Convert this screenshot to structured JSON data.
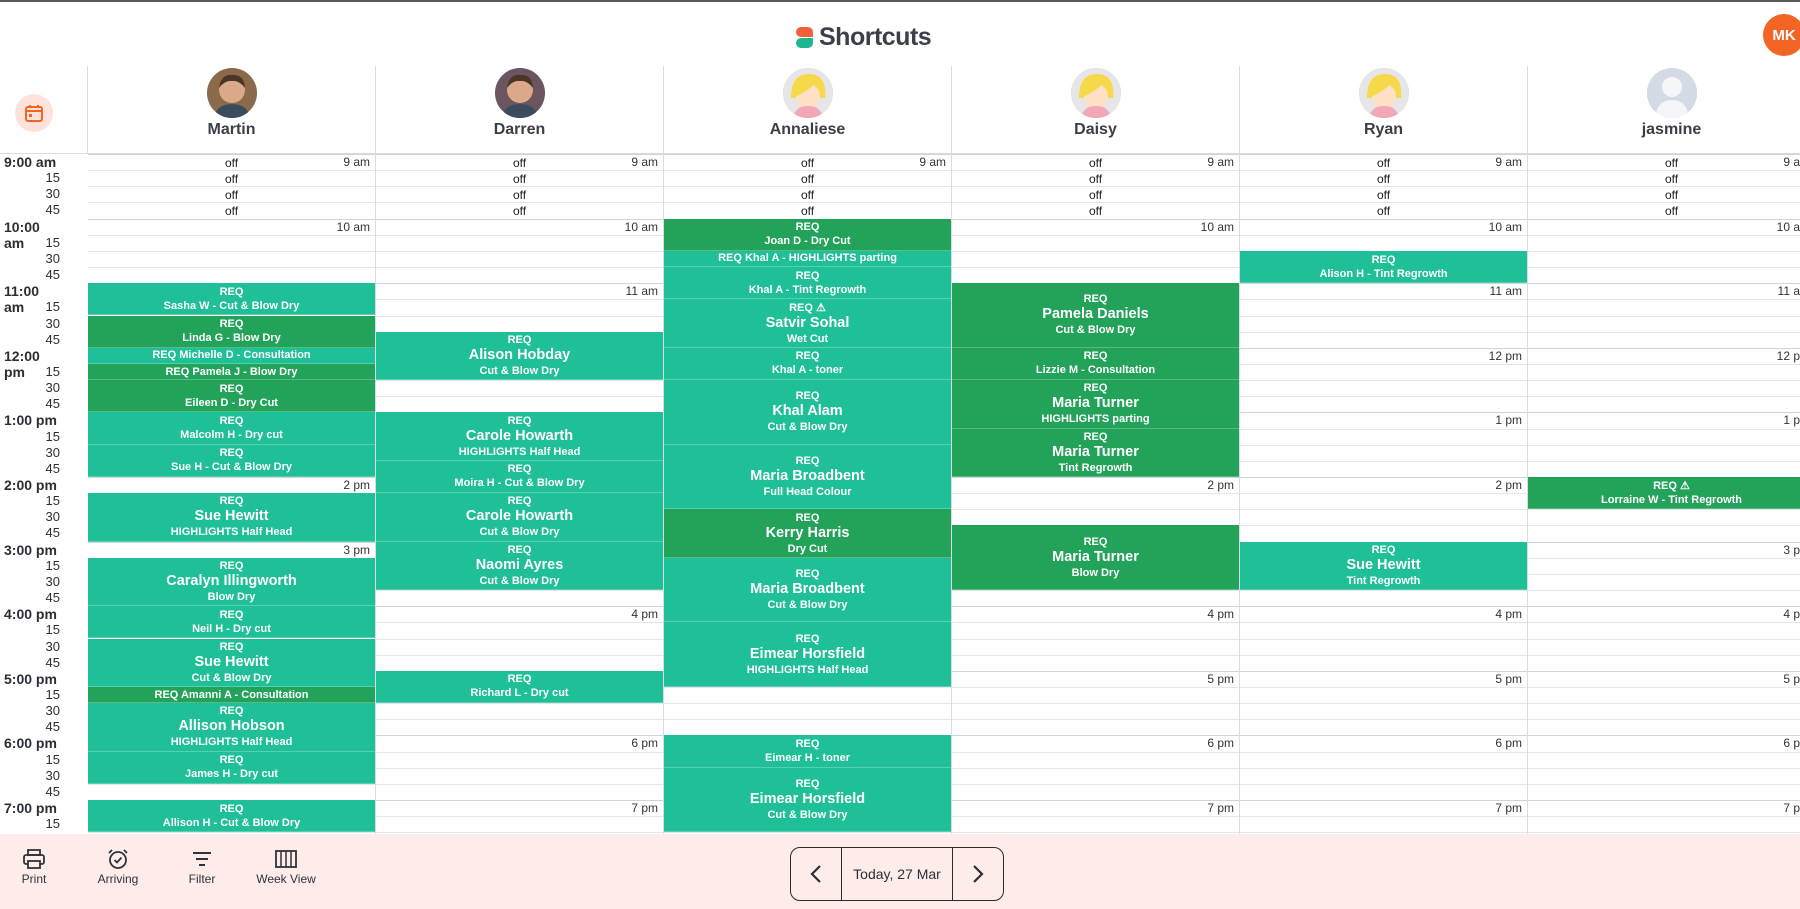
{
  "app": {
    "logo_text": "Shortcuts",
    "user_initials": "MK"
  },
  "colors": {
    "light_appt": "#1fbf97",
    "dark_appt": "#23a35a",
    "accent": "#f26524",
    "footer_bg": "#fdecea"
  },
  "time_labels": [
    "9:00 am",
    "15",
    "30",
    "45",
    "10:00 am",
    "15",
    "30",
    "45",
    "11:00 am",
    "15",
    "30",
    "45",
    "12:00 pm",
    "15",
    "30",
    "45",
    "1:00 pm",
    "15",
    "30",
    "45",
    "2:00 pm",
    "15",
    "30",
    "45",
    "3:00 pm",
    "15",
    "30",
    "45",
    "4:00 pm",
    "15",
    "30",
    "45",
    "5:00 pm",
    "15",
    "30",
    "45",
    "6:00 pm",
    "15",
    "30",
    "45",
    "7:00 pm",
    "15"
  ],
  "hour_markers": [
    "9 am",
    "10 am",
    "11 am",
    "12 pm",
    "1 pm",
    "2 pm",
    "3 pm",
    "4 pm",
    "5 pm",
    "6 pm",
    "7 pm"
  ],
  "off_label": "off",
  "staff": [
    {
      "name": "Martin",
      "photo": "photo",
      "photo_color": "#8a6a4a",
      "appointments": [
        {
          "start": 8,
          "span": 2,
          "style": "light",
          "lines": [
            "REQ",
            "Sasha W - Cut & Blow Dry"
          ]
        },
        {
          "start": 10,
          "span": 2,
          "style": "dark",
          "lines": [
            "REQ",
            "Linda G - Blow Dry"
          ]
        },
        {
          "start": 12,
          "span": 1,
          "style": "light",
          "lines": [
            "REQ  Michelle D - Consultation"
          ]
        },
        {
          "start": 13,
          "span": 1,
          "style": "dark",
          "lines": [
            "REQ  Pamela J - Blow Dry"
          ]
        },
        {
          "start": 14,
          "span": 2,
          "style": "dark",
          "lines": [
            "REQ",
            "Eileen D - Dry Cut"
          ]
        },
        {
          "start": 16,
          "span": 2,
          "style": "light",
          "lines": [
            "REQ",
            "Malcolm H - Dry cut"
          ]
        },
        {
          "start": 18,
          "span": 2,
          "style": "light",
          "lines": [
            "REQ",
            "Sue H - Cut & Blow Dry"
          ]
        },
        {
          "start": 21,
          "span": 3,
          "style": "light",
          "lines": [
            "REQ",
            "Sue Hewitt",
            "HIGHLIGHTS Half Head"
          ],
          "big": 1
        },
        {
          "start": 25,
          "span": 3,
          "style": "light",
          "lines": [
            "REQ",
            "Caralyn Illingworth",
            "Blow Dry"
          ],
          "big": 1
        },
        {
          "start": 28,
          "span": 2,
          "style": "light",
          "lines": [
            "REQ",
            "Neil H - Dry cut"
          ]
        },
        {
          "start": 30,
          "span": 3,
          "style": "light",
          "lines": [
            "REQ",
            "Sue Hewitt",
            "Cut & Blow Dry"
          ],
          "big": 1
        },
        {
          "start": 33,
          "span": 1,
          "style": "dark",
          "lines": [
            "REQ  Amanni A - Consultation"
          ]
        },
        {
          "start": 34,
          "span": 3,
          "style": "light",
          "lines": [
            "REQ",
            "Allison Hobson",
            "HIGHLIGHTS Half Head"
          ],
          "big": 1
        },
        {
          "start": 37,
          "span": 2,
          "style": "light",
          "lines": [
            "REQ",
            "James H - Dry cut"
          ]
        },
        {
          "start": 40,
          "span": 2,
          "style": "light",
          "lines": [
            "REQ",
            "Allison H - Cut & Blow Dry"
          ]
        }
      ]
    },
    {
      "name": "Darren",
      "photo": "photo",
      "photo_color": "#6a5560",
      "appointments": [
        {
          "start": 11,
          "span": 3,
          "style": "light",
          "lines": [
            "REQ",
            "Alison Hobday",
            "Cut & Blow Dry"
          ],
          "big": 1
        },
        {
          "start": 16,
          "span": 3,
          "style": "light",
          "lines": [
            "REQ",
            "Carole Howarth",
            "HIGHLIGHTS Half Head"
          ],
          "big": 1
        },
        {
          "start": 19,
          "span": 2,
          "style": "light",
          "lines": [
            "REQ",
            "Moira H - Cut & Blow Dry"
          ]
        },
        {
          "start": 21,
          "span": 3,
          "style": "light",
          "lines": [
            "REQ",
            "Carole Howarth",
            "Cut & Blow Dry"
          ],
          "big": 1
        },
        {
          "start": 24,
          "span": 3,
          "style": "light",
          "lines": [
            "REQ",
            "Naomi Ayres",
            "Cut & Blow Dry"
          ],
          "big": 1
        },
        {
          "start": 32,
          "span": 2,
          "style": "light",
          "lines": [
            "REQ",
            "Richard L - Dry cut"
          ]
        }
      ]
    },
    {
      "name": "Annaliese",
      "photo": "cartoon",
      "photo_color": "#e5e5e5",
      "appointments": [
        {
          "start": 4,
          "span": 2,
          "style": "dark",
          "lines": [
            "REQ",
            "Joan D - Dry Cut"
          ]
        },
        {
          "start": 6,
          "span": 1,
          "style": "light",
          "lines": [
            "REQ  Khal A - HIGHLIGHTS parting"
          ]
        },
        {
          "start": 7,
          "span": 2,
          "style": "light",
          "lines": [
            "REQ",
            "Khal A - Tint Regrowth"
          ]
        },
        {
          "start": 9,
          "span": 3,
          "style": "light",
          "lines": [
            "REQ ⚠",
            "Satvir Sohal",
            "Wet Cut"
          ],
          "big": 1
        },
        {
          "start": 12,
          "span": 2,
          "style": "light",
          "lines": [
            "REQ",
            "Khal A - toner"
          ]
        },
        {
          "start": 14,
          "span": 4,
          "style": "light",
          "lines": [
            "REQ",
            "Khal Alam",
            "Cut & Blow Dry"
          ],
          "big": 1
        },
        {
          "start": 18,
          "span": 4,
          "style": "light",
          "lines": [
            "REQ",
            "Maria Broadbent",
            "Full Head Colour"
          ],
          "big": 1
        },
        {
          "start": 22,
          "span": 3,
          "style": "dark",
          "lines": [
            "REQ",
            "Kerry Harris",
            "Dry Cut"
          ],
          "big": 1
        },
        {
          "start": 25,
          "span": 4,
          "style": "light",
          "lines": [
            "REQ",
            "Maria Broadbent",
            "Cut & Blow Dry"
          ],
          "big": 1
        },
        {
          "start": 29,
          "span": 4,
          "style": "light",
          "lines": [
            "REQ",
            "Eimear Horsfield",
            "HIGHLIGHTS Half Head"
          ],
          "big": 1
        },
        {
          "start": 36,
          "span": 2,
          "style": "light",
          "lines": [
            "REQ",
            "Eimear H - toner"
          ]
        },
        {
          "start": 38,
          "span": 4,
          "style": "light",
          "lines": [
            "REQ",
            "Eimear Horsfield",
            "Cut & Blow Dry"
          ],
          "big": 1
        }
      ]
    },
    {
      "name": "Daisy",
      "photo": "cartoon",
      "photo_color": "#e5e5e5",
      "appointments": [
        {
          "start": 8,
          "span": 4,
          "style": "dark",
          "lines": [
            "REQ",
            "Pamela Daniels",
            "Cut & Blow Dry"
          ],
          "big": 1
        },
        {
          "start": 12,
          "span": 2,
          "style": "dark",
          "lines": [
            "REQ",
            "Lizzie M - Consultation"
          ]
        },
        {
          "start": 14,
          "span": 3,
          "style": "dark",
          "lines": [
            "REQ",
            "Maria Turner",
            "HIGHLIGHTS parting"
          ],
          "big": 1
        },
        {
          "start": 17,
          "span": 3,
          "style": "dark",
          "lines": [
            "REQ",
            "Maria Turner",
            "Tint Regrowth"
          ],
          "big": 1
        },
        {
          "start": 23,
          "span": 4,
          "style": "dark",
          "lines": [
            "REQ",
            "Maria Turner",
            "Blow Dry"
          ],
          "big": 1
        }
      ]
    },
    {
      "name": "Ryan",
      "photo": "cartoon",
      "photo_color": "#e5e5e5",
      "appointments": [
        {
          "start": 6,
          "span": 2,
          "style": "light",
          "lines": [
            "REQ",
            "Alison H - Tint Regrowth"
          ]
        },
        {
          "start": 24,
          "span": 3,
          "style": "light",
          "lines": [
            "REQ",
            "Sue Hewitt",
            "Tint Regrowth"
          ],
          "big": 1
        }
      ]
    },
    {
      "name": "jasmine",
      "photo": "placeholder",
      "photo_color": "#cfd6e0",
      "appointments": [
        {
          "start": 20,
          "span": 2,
          "style": "dark",
          "lines": [
            "REQ ⚠",
            "Lorraine W - Tint Regrowth"
          ]
        }
      ]
    }
  ],
  "footer": {
    "print": "Print",
    "arriving": "Arriving",
    "filter": "Filter",
    "week_view": "Week View",
    "date_label": "Today, 27 Mar"
  }
}
